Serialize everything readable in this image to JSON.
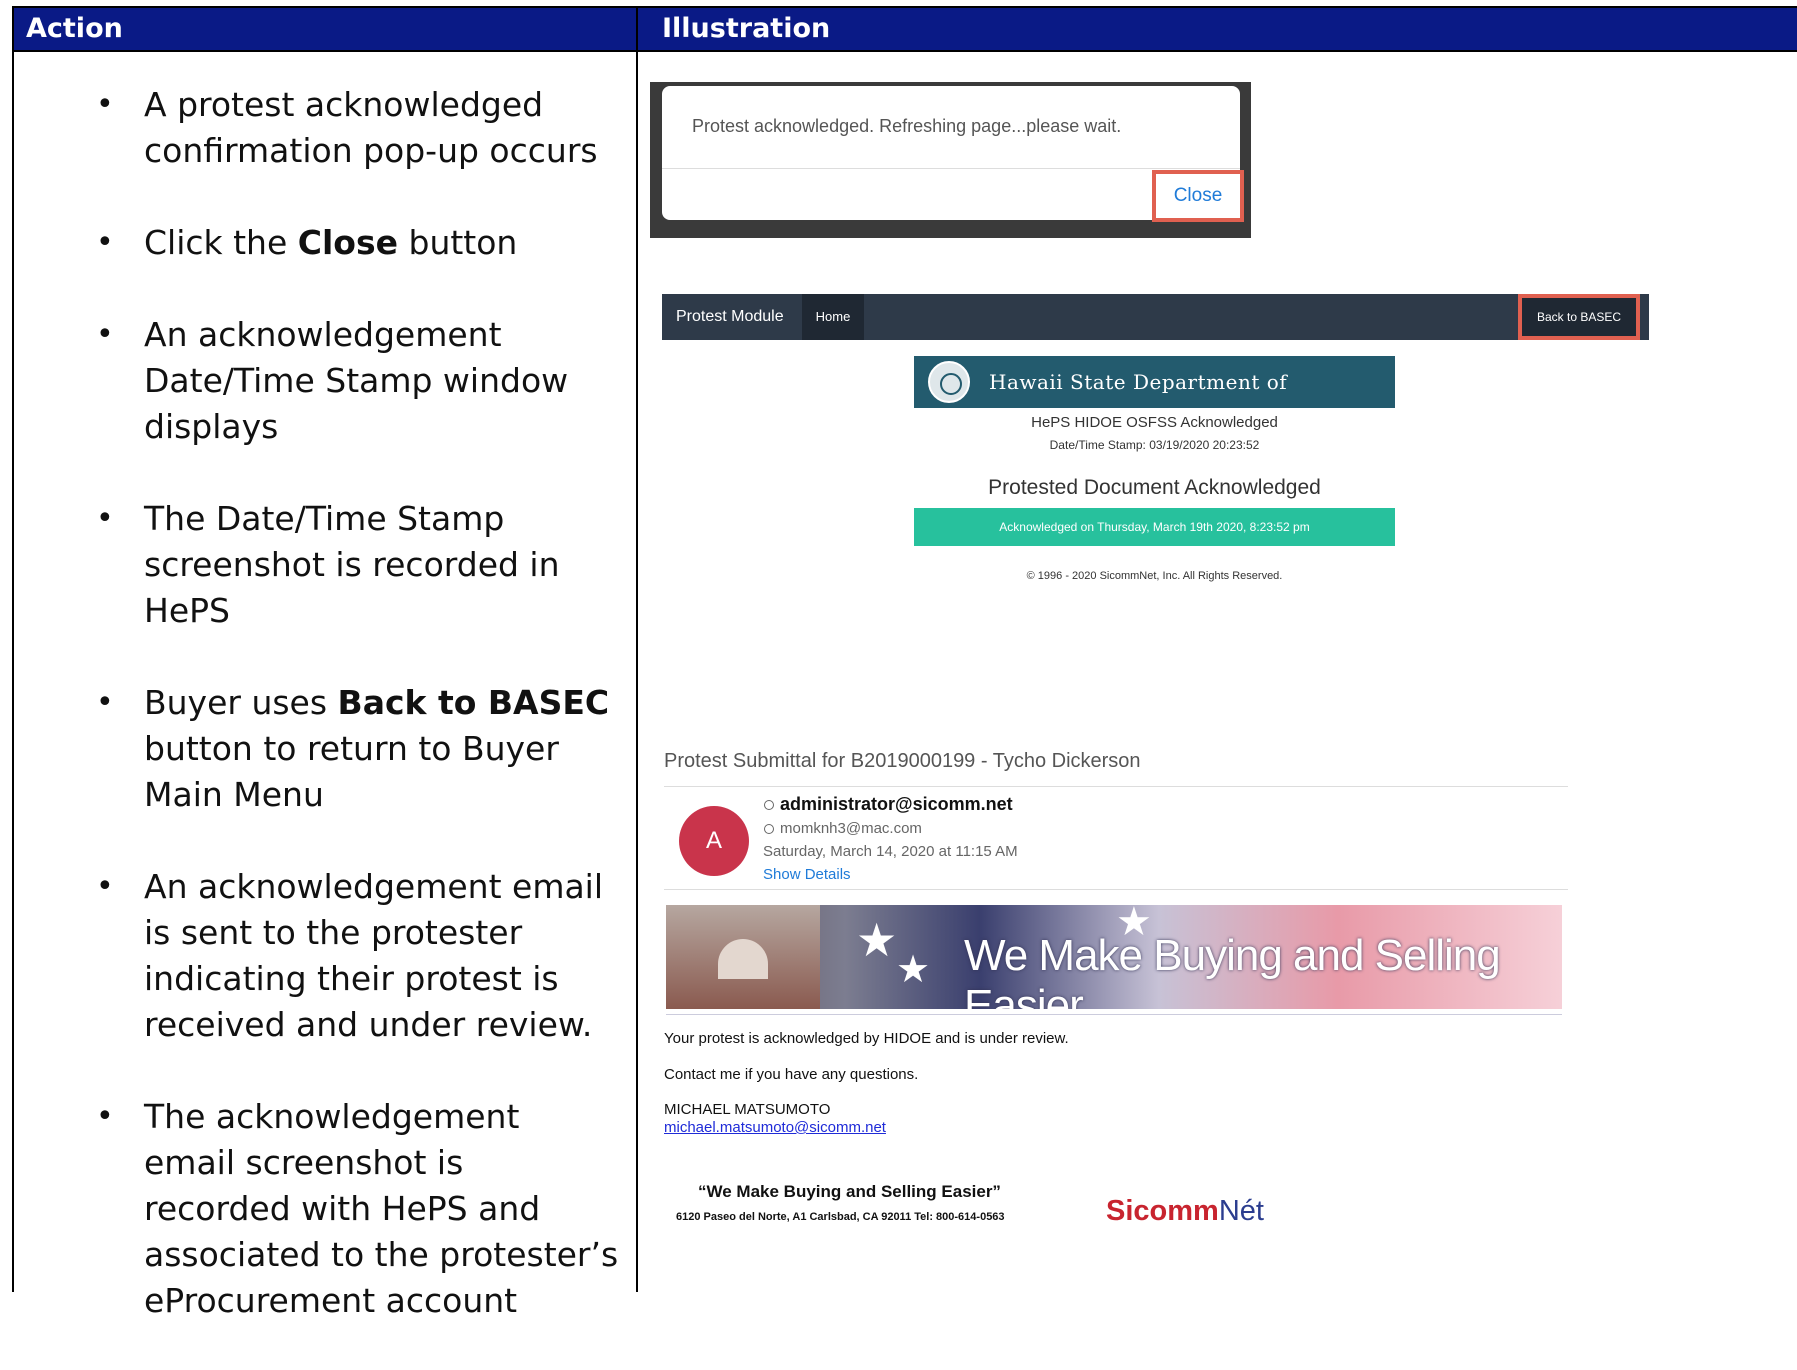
{
  "header": {
    "action": "Action",
    "illustration": "Illustration"
  },
  "actions": {
    "item1": "A protest acknowledged confirmation pop-up occurs",
    "item2_pre": "Click the ",
    "item2_bold": "Close",
    "item2_post": " button",
    "item3": "An acknowledgement Date/Time Stamp window displays",
    "item4": "The Date/Time Stamp screenshot is recorded in HePS",
    "item5_pre": "Buyer uses ",
    "item5_bold": "Back to BASEC",
    "item5_post": " button to return to Buyer Main Menu",
    "item6": "An acknowledgement email is sent to the protester indicating their protest is received and under review.",
    "item7": "The acknowledgement email screenshot is recorded with HePS and associated to the protester’s eProcurement account"
  },
  "popup": {
    "message": "Protest acknowledged. Refreshing page...please wait.",
    "close_label": "Close"
  },
  "protest_page": {
    "nav_title": "Protest Module",
    "nav_home": "Home",
    "nav_back": "Back to BASEC",
    "banner": "Hawaii State Department of Education",
    "ack_title": "HePS HIDOE OSFSS Acknowledged",
    "stamp": "Date/Time Stamp: 03/19/2020 20:23:52",
    "heading": "Protested Document Acknowledged",
    "ack_bar": "Acknowledged on Thursday, March 19th 2020, 8:23:52 pm",
    "copyright": "© 1996 - 2020 SicommNet, Inc. All Rights Reserved."
  },
  "email": {
    "subject": "Protest Submittal for B2019000199 - Tycho Dickerson",
    "avatar_letter": "A",
    "from": "administrator@sicomm.net",
    "to": "momknh3@mac.com",
    "date": "Saturday, March 14, 2020 at 11:15 AM",
    "show_details": "Show Details",
    "promo_text": "We Make Buying and Selling Easier.",
    "body1": "Your protest is acknowledged by HIDOE and is under review.",
    "body2": "Contact me if you have any questions.",
    "sender_name": "MICHAEL MATSUMOTO",
    "sender_email": "michael.matsumoto@sicomm.net",
    "sig_tagline": "“We Make Buying and Selling Easier”",
    "sig_address": "6120 Paseo del Norte, A1  Carlsbad, CA 92011 Tel: 800-614-0563",
    "logo_red": "Sicomm",
    "logo_blue": "Nét"
  }
}
